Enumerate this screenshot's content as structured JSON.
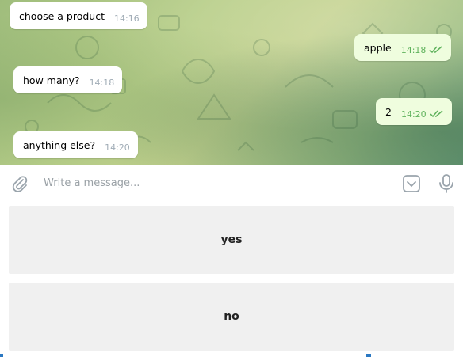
{
  "messages": [
    {
      "text": "choose a product",
      "time": "14:16",
      "direction": "in"
    },
    {
      "text": "apple",
      "time": "14:18",
      "direction": "out",
      "read": true
    },
    {
      "text": "how many?",
      "time": "14:18",
      "direction": "in"
    },
    {
      "text": "2",
      "time": "14:20",
      "direction": "out",
      "read": true
    },
    {
      "text": "anything else?",
      "time": "14:20",
      "direction": "in"
    }
  ],
  "composer": {
    "placeholder": "Write a message...",
    "value": ""
  },
  "keyboard": {
    "buttons": [
      {
        "label": "yes"
      },
      {
        "label": "no"
      }
    ]
  },
  "icons": {
    "attach": "paperclip-icon",
    "keyboard": "keyboard-toggle-icon",
    "voice": "microphone-icon",
    "read_status": "double-check-icon"
  },
  "colors": {
    "outgoing_bubble": "#effdde",
    "incoming_bubble": "#ffffff",
    "read_check": "#5fb25c",
    "keyboard_button": "#f0f0f0"
  }
}
